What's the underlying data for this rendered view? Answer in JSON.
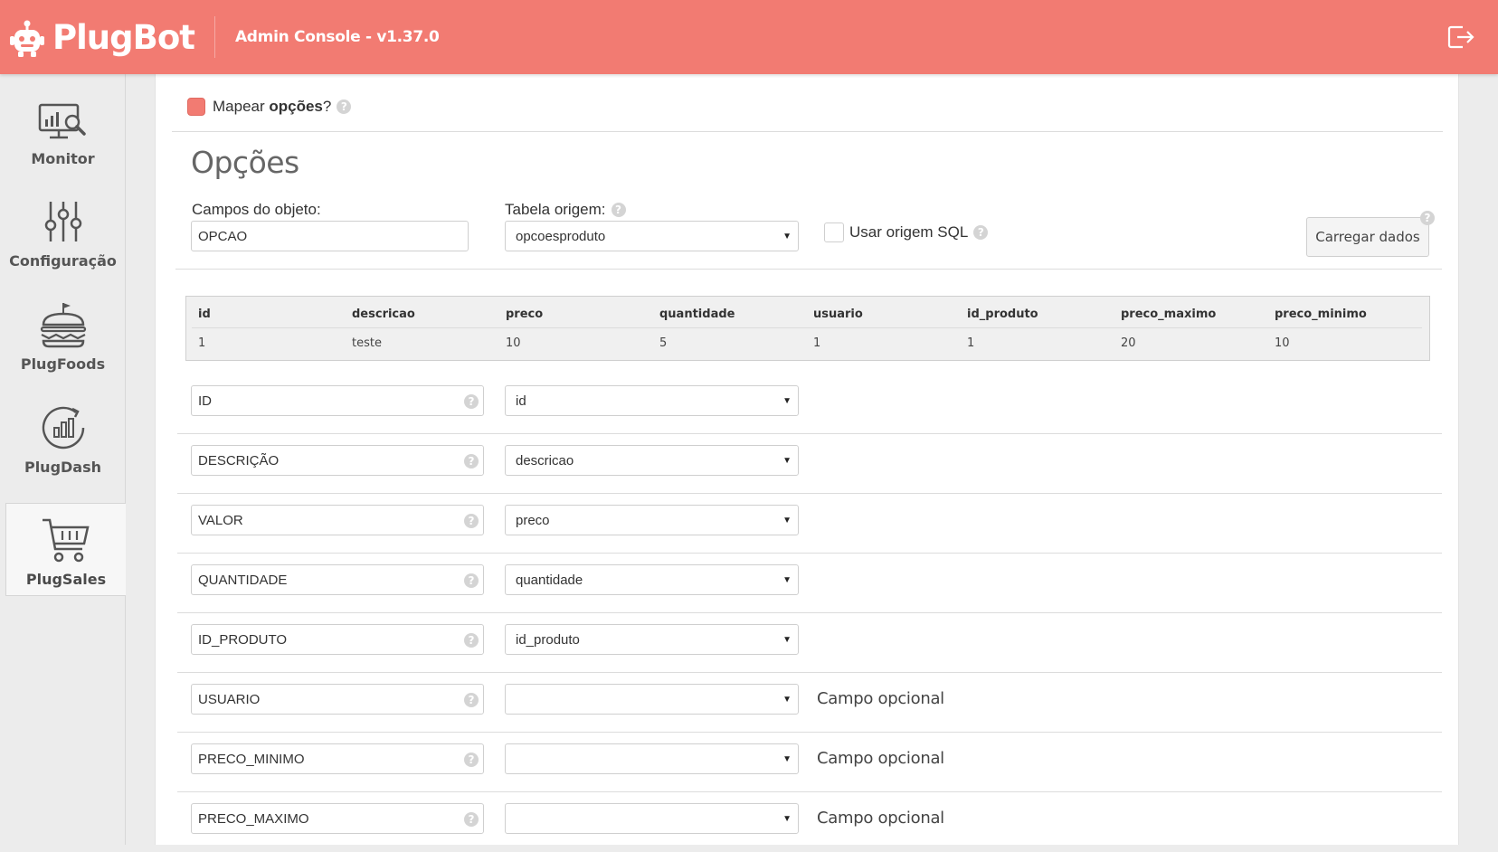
{
  "header": {
    "logo_text": "PlugBot",
    "title": "Admin Console - v1.37.0",
    "logout_icon": "logout-icon"
  },
  "sidebar": {
    "items": [
      {
        "label": "Monitor",
        "icon": "monitor-chart-icon",
        "active": false
      },
      {
        "label": "Configuração",
        "icon": "sliders-icon",
        "active": false
      },
      {
        "label": "PlugFoods",
        "icon": "burger-icon",
        "active": false
      },
      {
        "label": "PlugDash",
        "icon": "dashboard-chart-icon",
        "active": false
      },
      {
        "label": "PlugSales",
        "icon": "shopping-cart-icon",
        "active": true
      }
    ]
  },
  "colors": {
    "accent": "#f27b72",
    "background": "#ececec",
    "panel": "#ffffff"
  },
  "map_options": {
    "prefix": "Mapear ",
    "bold": "opções",
    "suffix": "?",
    "checked": true
  },
  "section": {
    "title": "Opções"
  },
  "form": {
    "campos_label": "Campos do objeto:",
    "campos_value": "OPCAO",
    "tabela_label": "Tabela origem:",
    "tabela_value": "opcoesproduto",
    "sql_label": "Usar origem SQL",
    "sql_checked": false,
    "load_button": "Carregar dados"
  },
  "preview": {
    "columns": [
      "id",
      "descricao",
      "preco",
      "quantidade",
      "usuario",
      "id_produto",
      "preco_maximo",
      "preco_minimo"
    ],
    "rows": [
      [
        "1",
        "teste",
        "10",
        "5",
        "1",
        "1",
        "20",
        "10"
      ]
    ]
  },
  "mappings": [
    {
      "field": "ID",
      "column": "id",
      "note": ""
    },
    {
      "field": "DESCRIÇÃO",
      "column": "descricao",
      "note": ""
    },
    {
      "field": "VALOR",
      "column": "preco",
      "note": ""
    },
    {
      "field": "QUANTIDADE",
      "column": "quantidade",
      "note": ""
    },
    {
      "field": "ID_PRODUTO",
      "column": "id_produto",
      "note": ""
    },
    {
      "field": "USUARIO",
      "column": "",
      "note": "Campo opcional"
    },
    {
      "field": "PRECO_MINIMO",
      "column": "",
      "note": "Campo opcional"
    },
    {
      "field": "PRECO_MAXIMO",
      "column": "",
      "note": "Campo opcional"
    }
  ]
}
